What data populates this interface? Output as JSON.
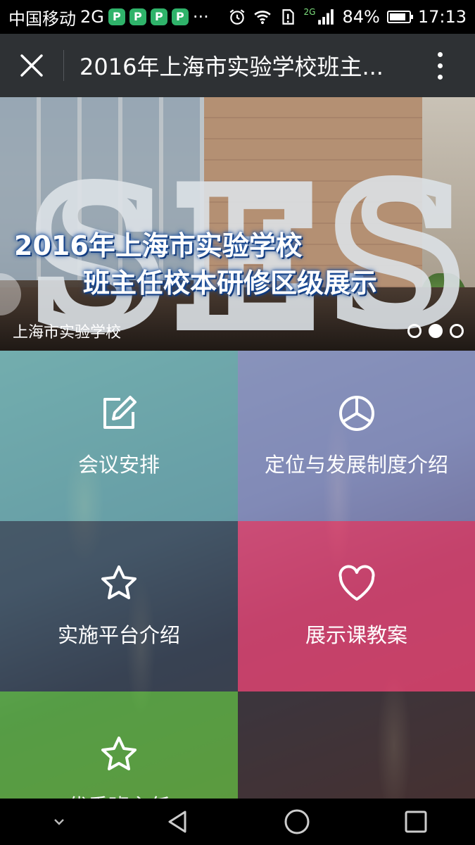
{
  "status_bar": {
    "carrier": "中国移动",
    "network": "2G",
    "app_icons": [
      "P",
      "P",
      "P",
      "P"
    ],
    "more": "···",
    "signal_network": "2G",
    "battery_percent": "84%",
    "battery_level": 0.84,
    "time": "17:13"
  },
  "title_bar": {
    "title": "2016年上海市实验学校班主..."
  },
  "banner": {
    "headline_line1": "2016年上海市实验学校",
    "headline_line2": "班主任校本研修区级展示",
    "sculpture_letters": [
      "S",
      "E",
      "S"
    ],
    "caption": "上海市实验学校",
    "slide_count": 3,
    "active_slide": 2
  },
  "tiles": [
    {
      "label": "会议安排",
      "icon": "edit-icon"
    },
    {
      "label": "定位与发展制度介绍",
      "icon": "pie-chart-icon"
    },
    {
      "label": "实施平台介绍",
      "icon": "star-icon"
    },
    {
      "label": "展示课教案",
      "icon": "heart-icon"
    },
    {
      "label": "优秀班主任",
      "icon": "star-icon"
    },
    {
      "label": "",
      "icon": ""
    }
  ],
  "nav_bar": {
    "buttons": [
      "chevron-down-icon",
      "back-icon",
      "home-icon",
      "recents-icon"
    ]
  }
}
